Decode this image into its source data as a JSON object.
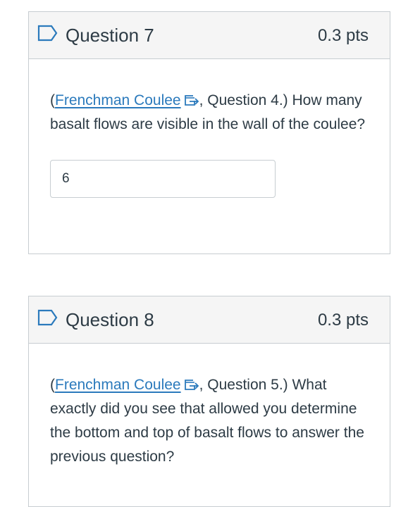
{
  "questions": [
    {
      "title": "Question 7",
      "points": "0.3 pts",
      "text_prefix": "(",
      "link_label": "Frenchman Coulee",
      "text_suffix": ", Question 4.) How many basalt flows are visible in the wall of the coulee?",
      "answer_value": "6"
    },
    {
      "title": "Question 8",
      "points": "0.3 pts",
      "text_prefix": "(",
      "link_label": "Frenchman Coulee",
      "text_suffix": ", Question 5.) What exactly did you see that allowed you determine the bottom and top of basalt flows to answer the previous question?"
    }
  ],
  "icons": {
    "flag": "flag-question-icon",
    "external": "external-link-icon"
  },
  "colors": {
    "link": "#2b7abc",
    "text": "#2d3b45",
    "border": "#c7cdd1",
    "header_bg": "#f5f5f5"
  }
}
